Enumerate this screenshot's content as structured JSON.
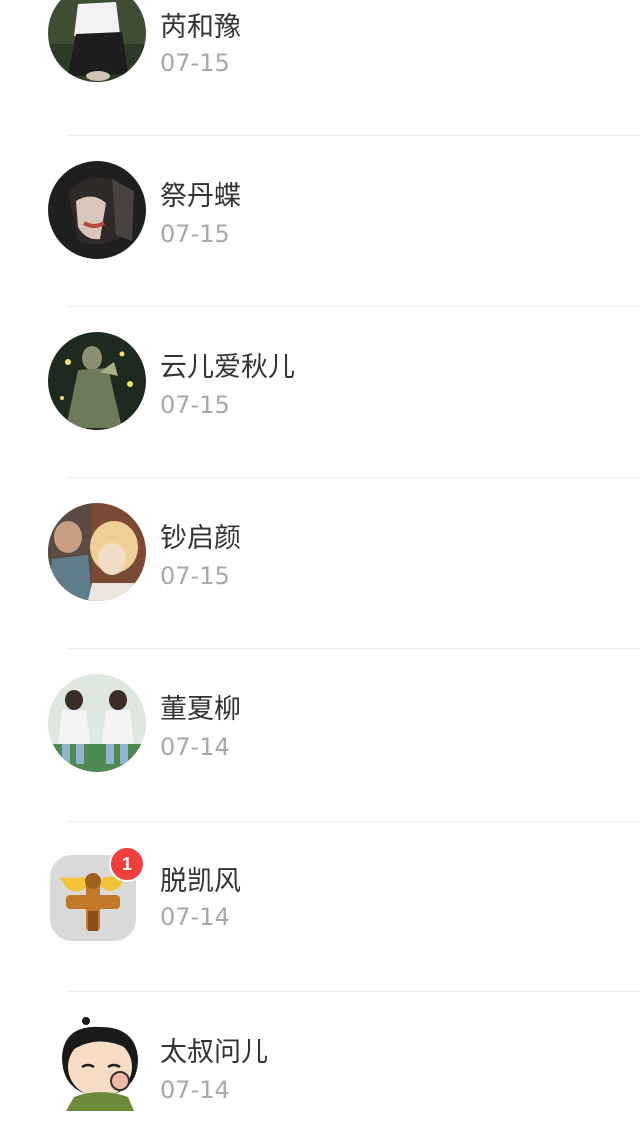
{
  "contacts": [
    {
      "name": "芮和豫",
      "date": "07-15",
      "avatar": "photo-person-white-top"
    },
    {
      "name": "祭丹蝶",
      "date": "07-15",
      "avatar": "photo-dark-portrait"
    },
    {
      "name": "云儿爱秋儿",
      "date": "07-15",
      "avatar": "photo-forest-fireflies"
    },
    {
      "name": "钞启颜",
      "date": "07-15",
      "avatar": "photo-blonde-child"
    },
    {
      "name": "董夏柳",
      "date": "07-14",
      "avatar": "photo-two-girls"
    },
    {
      "name": "脱凯风",
      "date": "07-14",
      "avatar": "app-icon-golden-cross",
      "badge": "1"
    },
    {
      "name": "太叔问儿",
      "date": "07-14",
      "avatar": "cartoon-baby"
    }
  ],
  "colors": {
    "name_text": "#333333",
    "date_text": "#a8a8a8",
    "divider": "#ececec",
    "badge": "#f0403c"
  }
}
